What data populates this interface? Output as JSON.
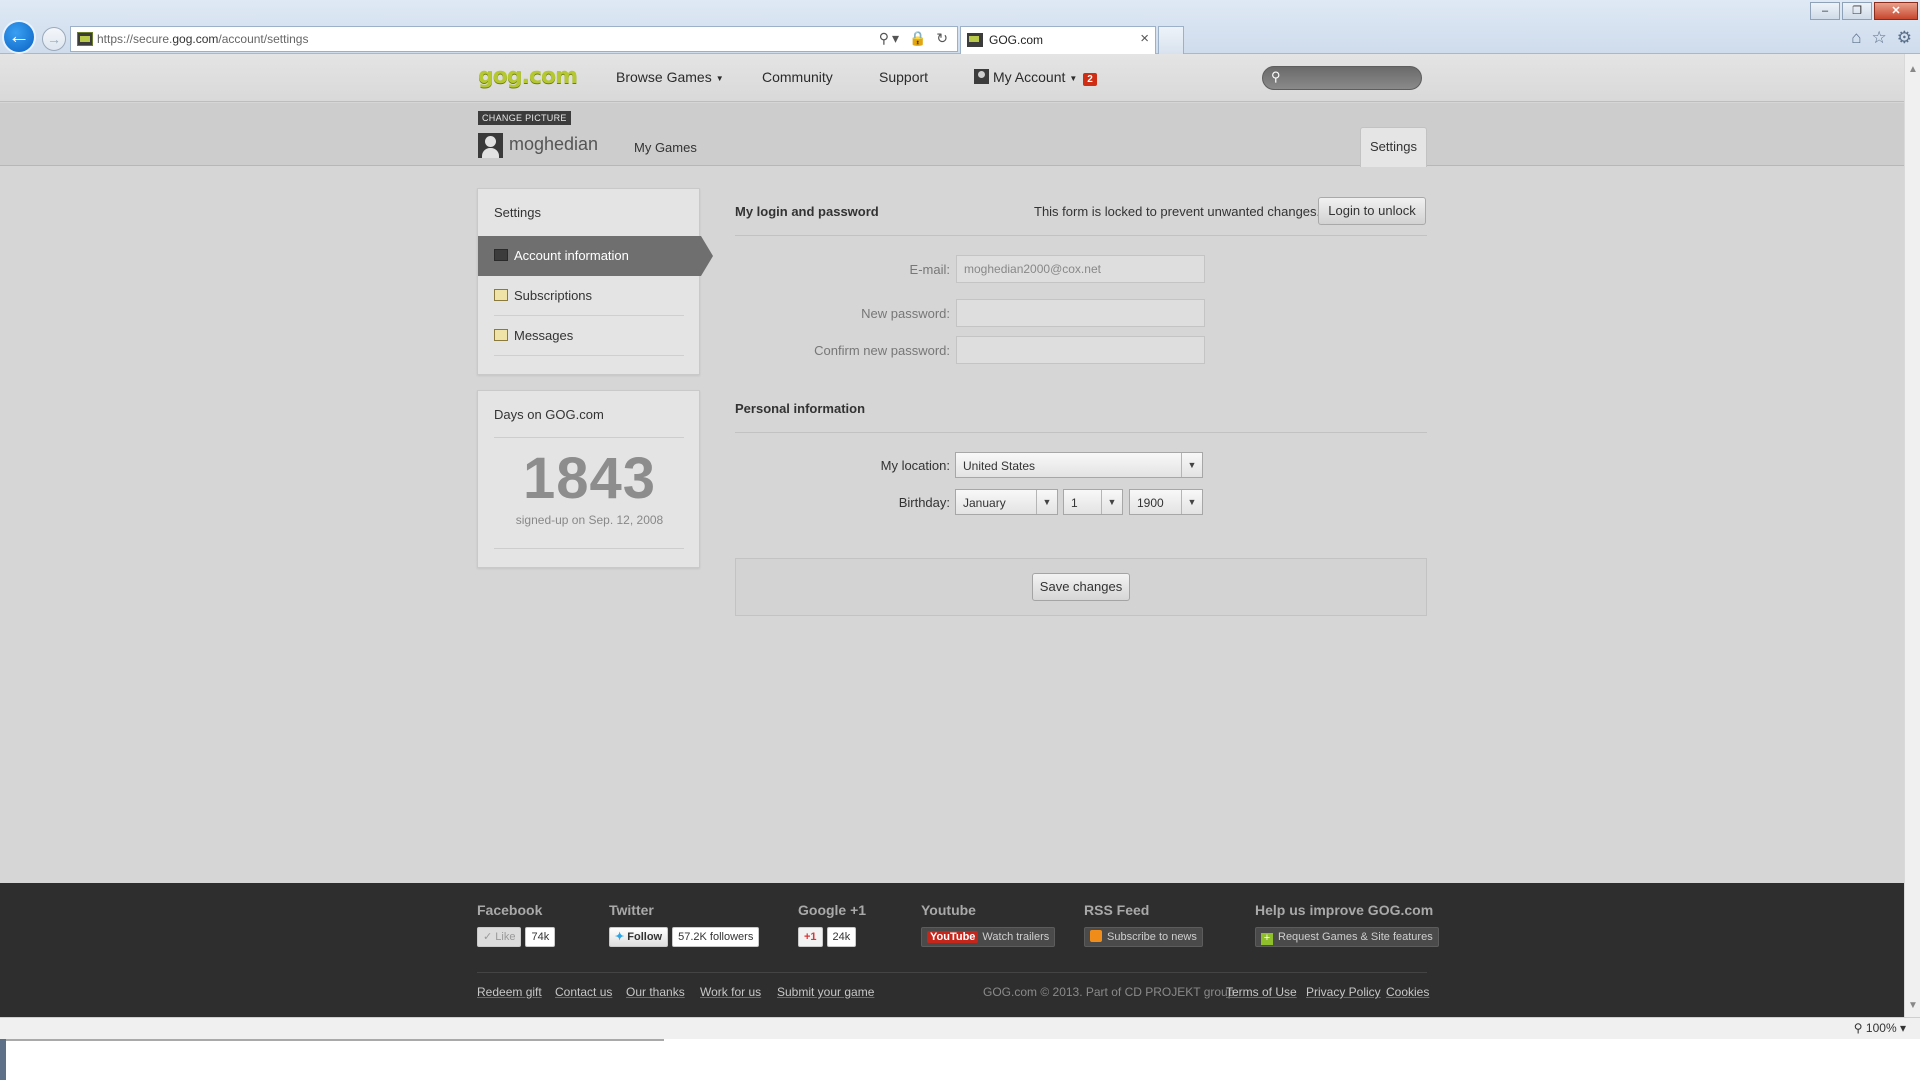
{
  "browser": {
    "url_prefix": "https://secure.",
    "url_domain": "gog.com",
    "url_path": "/account/settings",
    "tab_title": "GOG.com",
    "zoom": "100%"
  },
  "nav": {
    "logo": "gog.com",
    "browse": "Browse Games",
    "community": "Community",
    "support": "Support",
    "account": "My Account",
    "account_badge": "2"
  },
  "profile": {
    "change_picture": "CHANGE PICTURE",
    "username": "moghedian",
    "tab_mygames": "My Games",
    "tab_settings": "Settings"
  },
  "sidebar": {
    "title": "Settings",
    "items": [
      {
        "label": "Account information",
        "icon": "user-icon",
        "active": true
      },
      {
        "label": "Subscriptions",
        "icon": "newsletter-icon"
      },
      {
        "label": "Messages",
        "icon": "envelope-icon"
      }
    ]
  },
  "days": {
    "title": "Days on GOG.com",
    "count": "1843",
    "signup": "signed-up on Sep. 12, 2008"
  },
  "login": {
    "title": "My login and password",
    "lock_note": "This form is locked to prevent unwanted changes.",
    "unlock_label": "Login to unlock",
    "email_label": "E-mail:",
    "email_value": "moghedian2000@cox.net",
    "new_password_label": "New password:",
    "confirm_password_label": "Confirm new password:"
  },
  "personal": {
    "title": "Personal information",
    "location_label": "My location:",
    "location_value": "United States",
    "birthday_label": "Birthday:",
    "month": "January",
    "day": "1",
    "year": "1900"
  },
  "save_label": "Save changes",
  "footer": {
    "facebook": "Facebook",
    "fb_like": "Like",
    "fb_count": "74k",
    "twitter": "Twitter",
    "tw_follow": "Follow",
    "tw_count": "57.2K followers",
    "google": "Google +1",
    "g_plus": "+1",
    "g_count": "24k",
    "youtube": "Youtube",
    "yt_logo": "YouTube",
    "yt_label": "Watch trailers",
    "rss": "RSS Feed",
    "rss_label": "Subscribe to news",
    "help": "Help us improve GOG.com",
    "help_label": "Request Games & Site features",
    "links": [
      "Redeem gift",
      "Contact us",
      "Our thanks",
      "Work for us",
      "Submit your game"
    ],
    "copyright": "GOG.com © 2013. Part of CD PROJEKT group.",
    "legal": [
      "Terms of Use",
      "Privacy Policy",
      "Cookies"
    ]
  }
}
